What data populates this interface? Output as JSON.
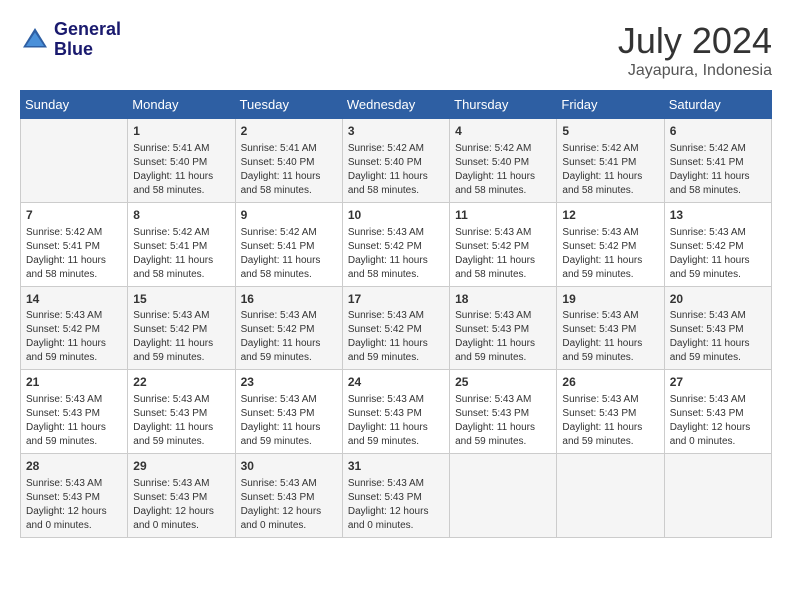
{
  "header": {
    "logo_line1": "General",
    "logo_line2": "Blue",
    "month_year": "July 2024",
    "location": "Jayapura, Indonesia"
  },
  "days_of_week": [
    "Sunday",
    "Monday",
    "Tuesday",
    "Wednesday",
    "Thursday",
    "Friday",
    "Saturday"
  ],
  "weeks": [
    [
      {
        "day": "",
        "sunrise": "",
        "sunset": "",
        "daylight": ""
      },
      {
        "day": "1",
        "sunrise": "Sunrise: 5:41 AM",
        "sunset": "Sunset: 5:40 PM",
        "daylight": "Daylight: 11 hours and 58 minutes."
      },
      {
        "day": "2",
        "sunrise": "Sunrise: 5:41 AM",
        "sunset": "Sunset: 5:40 PM",
        "daylight": "Daylight: 11 hours and 58 minutes."
      },
      {
        "day": "3",
        "sunrise": "Sunrise: 5:42 AM",
        "sunset": "Sunset: 5:40 PM",
        "daylight": "Daylight: 11 hours and 58 minutes."
      },
      {
        "day": "4",
        "sunrise": "Sunrise: 5:42 AM",
        "sunset": "Sunset: 5:40 PM",
        "daylight": "Daylight: 11 hours and 58 minutes."
      },
      {
        "day": "5",
        "sunrise": "Sunrise: 5:42 AM",
        "sunset": "Sunset: 5:41 PM",
        "daylight": "Daylight: 11 hours and 58 minutes."
      },
      {
        "day": "6",
        "sunrise": "Sunrise: 5:42 AM",
        "sunset": "Sunset: 5:41 PM",
        "daylight": "Daylight: 11 hours and 58 minutes."
      }
    ],
    [
      {
        "day": "7",
        "sunrise": "Sunrise: 5:42 AM",
        "sunset": "Sunset: 5:41 PM",
        "daylight": "Daylight: 11 hours and 58 minutes."
      },
      {
        "day": "8",
        "sunrise": "Sunrise: 5:42 AM",
        "sunset": "Sunset: 5:41 PM",
        "daylight": "Daylight: 11 hours and 58 minutes."
      },
      {
        "day": "9",
        "sunrise": "Sunrise: 5:42 AM",
        "sunset": "Sunset: 5:41 PM",
        "daylight": "Daylight: 11 hours and 58 minutes."
      },
      {
        "day": "10",
        "sunrise": "Sunrise: 5:43 AM",
        "sunset": "Sunset: 5:42 PM",
        "daylight": "Daylight: 11 hours and 58 minutes."
      },
      {
        "day": "11",
        "sunrise": "Sunrise: 5:43 AM",
        "sunset": "Sunset: 5:42 PM",
        "daylight": "Daylight: 11 hours and 58 minutes."
      },
      {
        "day": "12",
        "sunrise": "Sunrise: 5:43 AM",
        "sunset": "Sunset: 5:42 PM",
        "daylight": "Daylight: 11 hours and 59 minutes."
      },
      {
        "day": "13",
        "sunrise": "Sunrise: 5:43 AM",
        "sunset": "Sunset: 5:42 PM",
        "daylight": "Daylight: 11 hours and 59 minutes."
      }
    ],
    [
      {
        "day": "14",
        "sunrise": "Sunrise: 5:43 AM",
        "sunset": "Sunset: 5:42 PM",
        "daylight": "Daylight: 11 hours and 59 minutes."
      },
      {
        "day": "15",
        "sunrise": "Sunrise: 5:43 AM",
        "sunset": "Sunset: 5:42 PM",
        "daylight": "Daylight: 11 hours and 59 minutes."
      },
      {
        "day": "16",
        "sunrise": "Sunrise: 5:43 AM",
        "sunset": "Sunset: 5:42 PM",
        "daylight": "Daylight: 11 hours and 59 minutes."
      },
      {
        "day": "17",
        "sunrise": "Sunrise: 5:43 AM",
        "sunset": "Sunset: 5:42 PM",
        "daylight": "Daylight: 11 hours and 59 minutes."
      },
      {
        "day": "18",
        "sunrise": "Sunrise: 5:43 AM",
        "sunset": "Sunset: 5:43 PM",
        "daylight": "Daylight: 11 hours and 59 minutes."
      },
      {
        "day": "19",
        "sunrise": "Sunrise: 5:43 AM",
        "sunset": "Sunset: 5:43 PM",
        "daylight": "Daylight: 11 hours and 59 minutes."
      },
      {
        "day": "20",
        "sunrise": "Sunrise: 5:43 AM",
        "sunset": "Sunset: 5:43 PM",
        "daylight": "Daylight: 11 hours and 59 minutes."
      }
    ],
    [
      {
        "day": "21",
        "sunrise": "Sunrise: 5:43 AM",
        "sunset": "Sunset: 5:43 PM",
        "daylight": "Daylight: 11 hours and 59 minutes."
      },
      {
        "day": "22",
        "sunrise": "Sunrise: 5:43 AM",
        "sunset": "Sunset: 5:43 PM",
        "daylight": "Daylight: 11 hours and 59 minutes."
      },
      {
        "day": "23",
        "sunrise": "Sunrise: 5:43 AM",
        "sunset": "Sunset: 5:43 PM",
        "daylight": "Daylight: 11 hours and 59 minutes."
      },
      {
        "day": "24",
        "sunrise": "Sunrise: 5:43 AM",
        "sunset": "Sunset: 5:43 PM",
        "daylight": "Daylight: 11 hours and 59 minutes."
      },
      {
        "day": "25",
        "sunrise": "Sunrise: 5:43 AM",
        "sunset": "Sunset: 5:43 PM",
        "daylight": "Daylight: 11 hours and 59 minutes."
      },
      {
        "day": "26",
        "sunrise": "Sunrise: 5:43 AM",
        "sunset": "Sunset: 5:43 PM",
        "daylight": "Daylight: 11 hours and 59 minutes."
      },
      {
        "day": "27",
        "sunrise": "Sunrise: 5:43 AM",
        "sunset": "Sunset: 5:43 PM",
        "daylight": "Daylight: 12 hours and 0 minutes."
      }
    ],
    [
      {
        "day": "28",
        "sunrise": "Sunrise: 5:43 AM",
        "sunset": "Sunset: 5:43 PM",
        "daylight": "Daylight: 12 hours and 0 minutes."
      },
      {
        "day": "29",
        "sunrise": "Sunrise: 5:43 AM",
        "sunset": "Sunset: 5:43 PM",
        "daylight": "Daylight: 12 hours and 0 minutes."
      },
      {
        "day": "30",
        "sunrise": "Sunrise: 5:43 AM",
        "sunset": "Sunset: 5:43 PM",
        "daylight": "Daylight: 12 hours and 0 minutes."
      },
      {
        "day": "31",
        "sunrise": "Sunrise: 5:43 AM",
        "sunset": "Sunset: 5:43 PM",
        "daylight": "Daylight: 12 hours and 0 minutes."
      },
      {
        "day": "",
        "sunrise": "",
        "sunset": "",
        "daylight": ""
      },
      {
        "day": "",
        "sunrise": "",
        "sunset": "",
        "daylight": ""
      },
      {
        "day": "",
        "sunrise": "",
        "sunset": "",
        "daylight": ""
      }
    ]
  ]
}
